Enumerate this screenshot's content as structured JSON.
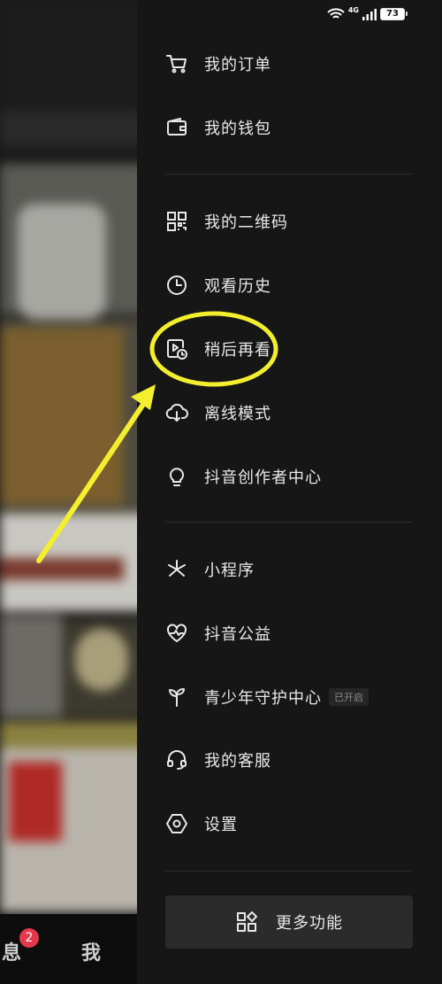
{
  "status_bar": {
    "network": "4G",
    "battery": "73"
  },
  "bottom_nav": {
    "messages_label": "息",
    "messages_badge": "2",
    "me_label": "我"
  },
  "drawer": {
    "menu": [
      {
        "label": "我的订单",
        "icon": "cart-icon"
      },
      {
        "label": "我的钱包",
        "icon": "wallet-icon"
      },
      {
        "label": "我的二维码",
        "icon": "qrcode-icon"
      },
      {
        "label": "观看历史",
        "icon": "clock-icon"
      },
      {
        "label": "稍后再看",
        "icon": "watch-later-icon"
      },
      {
        "label": "离线模式",
        "icon": "cloud-download-icon"
      },
      {
        "label": "抖音创作者中心",
        "icon": "lightbulb-icon"
      },
      {
        "label": "小程序",
        "icon": "miniprogram-icon"
      },
      {
        "label": "抖音公益",
        "icon": "heart-icon"
      },
      {
        "label": "青少年守护中心",
        "icon": "sprout-icon",
        "tag": "已开启"
      },
      {
        "label": "我的客服",
        "icon": "headset-icon"
      },
      {
        "label": "设置",
        "icon": "settings-icon"
      }
    ],
    "more_button": {
      "label": "更多功能",
      "icon": "grid-icon"
    }
  },
  "colors": {
    "drawer_bg": "#161616",
    "annotation": "#f3ef2e",
    "badge": "#e5384b"
  }
}
